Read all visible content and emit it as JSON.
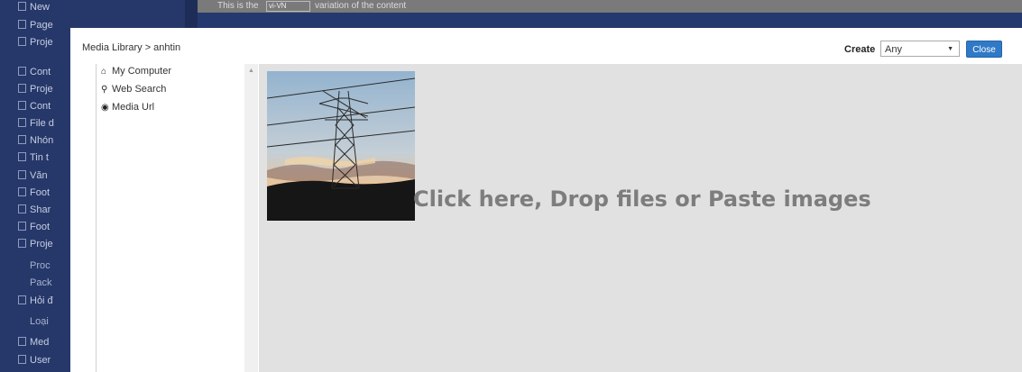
{
  "background": {
    "top_text_prefix": "This is the",
    "top_select_value": "vi-VN",
    "top_text_suffix": "variation of the content",
    "sidebar_items": [
      {
        "label": "New",
        "sub": false
      },
      {
        "label": "Page",
        "sub": false
      },
      {
        "label": "Proje",
        "sub": false
      },
      {
        "label": "Cont",
        "sub": false
      },
      {
        "label": "Proje",
        "sub": false
      },
      {
        "label": "Cont",
        "sub": false
      },
      {
        "label": "File d",
        "sub": false
      },
      {
        "label": "Nhón",
        "sub": false
      },
      {
        "label": "Tin t",
        "sub": false
      },
      {
        "label": "Văn",
        "sub": false
      },
      {
        "label": "Foot",
        "sub": false
      },
      {
        "label": "Shar",
        "sub": false
      },
      {
        "label": "Foot",
        "sub": false
      },
      {
        "label": "Proje",
        "sub": false
      },
      {
        "label": "Proc",
        "sub": true
      },
      {
        "label": "Pack",
        "sub": true
      },
      {
        "label": "Hỏi đ",
        "sub": false
      },
      {
        "label": "Loại",
        "sub": true
      },
      {
        "label": "Med",
        "sub": false
      },
      {
        "label": "User",
        "sub": false
      }
    ]
  },
  "modal": {
    "breadcrumb": "Media Library > anhtin",
    "create_label": "Create",
    "create_select_value": "Any",
    "close_label": "Close",
    "nav": [
      {
        "icon": "home-icon",
        "glyph": "⌂",
        "label": "My Computer"
      },
      {
        "icon": "search-icon",
        "glyph": "⚲",
        "label": "Web Search"
      },
      {
        "icon": "link-circle-icon",
        "glyph": "◉",
        "label": "Media Url"
      }
    ],
    "drop_text": "Click here, Drop files or Paste images",
    "thumbnail": {
      "subject": "power transmission tower at sunset"
    }
  },
  "colors": {
    "close_button": "#2f79c6",
    "sidebar": "#26386a",
    "drop_zone": "#e1e1e1"
  }
}
